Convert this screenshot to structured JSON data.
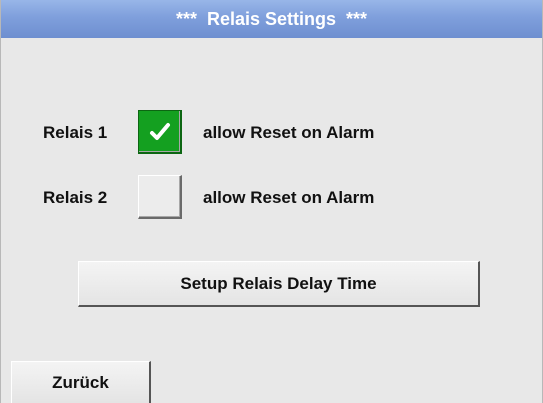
{
  "title": "***  Relais Settings  ***",
  "relais": [
    {
      "label": "Relais 1",
      "checked": true,
      "option_label": "allow Reset on Alarm"
    },
    {
      "label": "Relais 2",
      "checked": false,
      "option_label": "allow Reset on Alarm"
    }
  ],
  "setup_button_label": "Setup Relais Delay Time",
  "back_button_label": "Zurück",
  "colors": {
    "title_bar": "#7f9fdc",
    "checked_fill": "#14a020",
    "background": "#e8e8e8"
  },
  "icons": {
    "checked": "checkmark-icon"
  }
}
